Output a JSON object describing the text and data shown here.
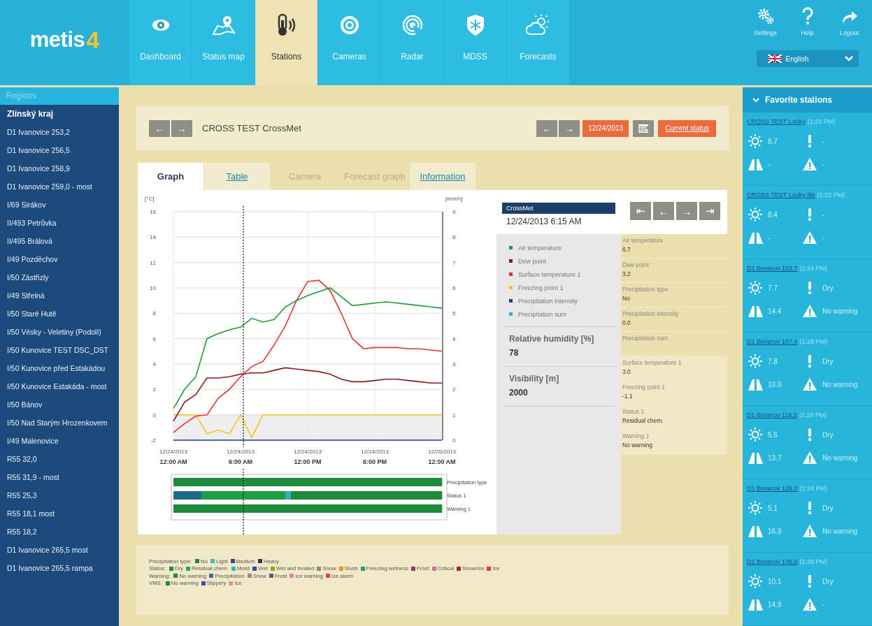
{
  "header": {
    "logo": {
      "text": "metis",
      "digit": "4"
    },
    "nav": [
      {
        "label": "Dashboard",
        "selected": false
      },
      {
        "label": "Status map",
        "selected": false
      },
      {
        "label": "Stations",
        "selected": true
      },
      {
        "label": "Cameras",
        "selected": false
      },
      {
        "label": "Radar",
        "selected": false
      },
      {
        "label": "MDSS",
        "selected": false
      },
      {
        "label": "Forecasts",
        "selected": false
      }
    ],
    "tools": [
      "Settings",
      "Help",
      "Logout"
    ],
    "language": "English"
  },
  "sidebar": {
    "title": "Regions",
    "region": "Zlínský kraj",
    "items": [
      "D1 Ivanovice 253,2",
      "D1 Ivanovice 256,5",
      "D1 Ivanovice 258,9",
      "D1 Ivanovice 259,0 - most",
      "I/69 Sirákov",
      "II/493 Petrůvka",
      "II/495 Brálová",
      "I/49 Pozděchov",
      "I/50 Zástřizly",
      "I/49 Střelná",
      "I/50 Staré Hutě",
      "I/50 Vésky - Veletiny (Podolí)",
      "I/50 Kunovice TEST DSC_DST",
      "I/50 Kunovice před Estakádou",
      "I/50 Kunovice Estakáda - most",
      "I/50 Bánov",
      "I/50 Nad Starým Hrozenkovem",
      "I/49 Malenovice",
      "R55 32,0",
      "R55 31,9 - most",
      "R55 25,3",
      "R55 18,1 most",
      "R55 18,2",
      "D1 Ivanovice 265,5 most",
      "D1 Ivanovice 265,5 rampa"
    ]
  },
  "station": {
    "prev": "←",
    "next": "→",
    "name": "CROSS TEST CrossMet",
    "date_prev": "←",
    "date_next": "→",
    "date": "12/24/2013",
    "current": "Current status"
  },
  "tabs": [
    {
      "label": "Graph",
      "selected": true,
      "disabled": false
    },
    {
      "label": "Table",
      "selected": false,
      "disabled": false
    },
    {
      "label": "Camera",
      "selected": false,
      "disabled": true
    },
    {
      "label": "Forecast graph",
      "selected": false,
      "disabled": true
    },
    {
      "label": "Information",
      "selected": false,
      "disabled": false
    }
  ],
  "graph": {
    "chart_data": {
      "type": "line",
      "ylabel": "[°C]",
      "y2label": "[mm/h]",
      "grid": true,
      "ylim": [
        -2,
        16
      ],
      "y2lim": [
        0,
        9
      ],
      "yticks": [
        -2,
        0,
        2,
        4,
        6,
        8,
        10,
        12,
        14,
        16
      ],
      "y2ticks": [
        0,
        1,
        2,
        3,
        4,
        5,
        6,
        7,
        8,
        9
      ],
      "categories": [
        "12/24/2013 **12:00 AM**",
        null,
        null,
        null,
        null,
        null,
        "12/24/2013 **6:00 AM**",
        null,
        null,
        null,
        null,
        null,
        "12/24/2013 **12:00 PM**",
        null,
        null,
        null,
        null,
        null,
        "12/24/2013 **6:00 PM**",
        null,
        null,
        null,
        null,
        null,
        "12/25/2013 **12:00 AM**"
      ],
      "series": [
        {
          "name": "Air temperature",
          "color": "#1e9a3c",
          "values": [
            0.5,
            2.0,
            3.0,
            6.0,
            6.4,
            6.7,
            6.9,
            7.6,
            7.3,
            7.5,
            8.5,
            9.0,
            9.4,
            9.7,
            10.0,
            9.3,
            8.6,
            8.7,
            8.8,
            8.9,
            8.8,
            8.7,
            8.6,
            8.5,
            8.4
          ]
        },
        {
          "name": "Dew point",
          "color": "#8a1a1a",
          "values": [
            -0.5,
            1.0,
            1.6,
            2.9,
            2.9,
            3.0,
            3.2,
            3.3,
            3.3,
            3.5,
            3.7,
            3.6,
            3.5,
            3.4,
            3.2,
            2.8,
            2.6,
            2.6,
            2.7,
            2.8,
            2.8,
            2.7,
            2.6,
            2.5,
            2.5
          ]
        },
        {
          "name": "Surface temperature 1",
          "color": "#e83030",
          "values": [
            -1.4,
            -0.7,
            -0.1,
            0.0,
            1.3,
            2.0,
            3.0,
            3.8,
            4.2,
            5.5,
            7.0,
            9.0,
            10.5,
            10.6,
            9.8,
            8.0,
            6.0,
            5.2,
            5.3,
            5.3,
            5.3,
            5.2,
            5.2,
            5.1,
            5.0
          ]
        },
        {
          "name": "Freezing point 1",
          "color": "#f0c81e",
          "values": [
            0,
            0,
            0,
            -1.5,
            -1.2,
            -1.5,
            0,
            -1.8,
            0,
            0,
            0,
            0,
            0,
            0,
            0,
            0,
            0,
            0,
            0,
            0,
            0,
            0,
            0,
            0,
            0
          ]
        },
        {
          "name": "Precipitation intensity",
          "color": "#1e3f8a",
          "axis": "y2",
          "values": [
            0,
            0,
            0,
            0,
            0,
            0,
            0,
            0,
            0,
            0,
            0,
            0,
            0,
            0,
            0,
            0,
            0,
            0,
            0,
            0,
            0,
            0,
            0,
            0,
            0
          ]
        },
        {
          "name": "Precipitation sum",
          "color": "#2ab0d8",
          "axis": "y2",
          "values": [
            null,
            null,
            null,
            null,
            null,
            null,
            null,
            null,
            null,
            null,
            null,
            null,
            null,
            null,
            null,
            null,
            null,
            null,
            null,
            null,
            null,
            null,
            null,
            null,
            null
          ]
        }
      ],
      "bands": [
        {
          "axis": "y",
          "from": -2,
          "to": 0,
          "color": "#eeeeee"
        }
      ]
    },
    "status_bars": [
      {
        "label": "Precipitation type",
        "slots": [
          {
            "color": "#1e8a3c"
          }
        ]
      },
      {
        "label": "Status 1",
        "slots": [
          {
            "color": "#1e6a8a"
          },
          {
            "color": "#1e6a8a"
          },
          {
            "color": "#1e6a8a"
          },
          {
            "color": "#1e6a8a"
          },
          {
            "color": "#1e6a8a"
          },
          {
            "color": "#1f9e48"
          },
          {
            "color": "#1f9e48"
          },
          {
            "color": "#1f9e48"
          },
          {
            "color": "#1f9e48"
          },
          {
            "color": "#1f9e48"
          },
          {
            "color": "#1f9e48"
          },
          {
            "color": "#1f9e48"
          },
          {
            "color": "#1f9e48"
          },
          {
            "color": "#1f9e48"
          },
          {
            "color": "#1f9e48"
          },
          {
            "color": "#1f9e48"
          },
          {
            "color": "#1f9e48"
          },
          {
            "color": "#1f9e48"
          },
          {
            "color": "#1f9e48"
          },
          {
            "color": "#1f9e48"
          },
          {
            "color": "#2ab0c0"
          },
          {
            "color": "#1e8a3c"
          },
          {
            "color": "#1e8a3c"
          },
          {
            "color": "#1e8a3c"
          },
          {
            "color": "#1e8a3c"
          },
          {
            "color": "#1e8a3c"
          },
          {
            "color": "#1e8a3c"
          },
          {
            "color": "#1e8a3c"
          },
          {
            "color": "#1e8a3c"
          },
          {
            "color": "#1e8a3c"
          },
          {
            "color": "#1e8a3c"
          },
          {
            "color": "#1e8a3c"
          },
          {
            "color": "#1e8a3c"
          },
          {
            "color": "#1e8a3c"
          },
          {
            "color": "#1e8a3c"
          },
          {
            "color": "#1e8a3c"
          },
          {
            "color": "#1e8a3c"
          },
          {
            "color": "#1e8a3c"
          },
          {
            "color": "#1e8a3c"
          },
          {
            "color": "#1e8a3c"
          },
          {
            "color": "#1e8a3c"
          },
          {
            "color": "#1e8a3c"
          },
          {
            "color": "#1e8a3c"
          },
          {
            "color": "#1e8a3c"
          },
          {
            "color": "#1e8a3c"
          },
          {
            "color": "#1e8a3c"
          },
          {
            "color": "#1e8a3c"
          },
          {
            "color": "#1e8a3c"
          }
        ]
      },
      {
        "label": "Warning 1",
        "slots": [
          {
            "color": "#1e8a3c"
          }
        ]
      }
    ]
  },
  "info": {
    "station": "CrossMet",
    "time": "12/24/2013 6:15 AM",
    "nav_buttons": [
      "⇤",
      "←",
      "→",
      "⇥"
    ],
    "extras": [
      {
        "label": "Relative humidity [%]",
        "value": "78"
      },
      {
        "label": "Visibility [m]",
        "value": "2000"
      }
    ],
    "groups": [
      [
        {
          "label": "Air temperature",
          "value": "6.7"
        },
        {
          "label": "Dew point",
          "value": "3.2"
        },
        {
          "label": "Precipitation type",
          "value": "No"
        },
        {
          "label": "Precipitation intensity",
          "value": "0.0"
        },
        {
          "label": "Precipitation sum"
        }
      ],
      [
        {
          "label": "Surface temperature 1",
          "value": "3.0"
        },
        {
          "label": "Freezing point 1",
          "value": "-1.1"
        },
        {
          "label": "Status 1",
          "value": "Residual chem."
        },
        {
          "label": "Warning 1",
          "value": "No warning"
        }
      ]
    ]
  },
  "legend": [
    {
      "label": "Precipitation type:",
      "items": [
        {
          "name": "No",
          "color": "#1e8a3c"
        },
        {
          "name": "Light",
          "color": "#3cc0c8"
        },
        {
          "name": "Medium",
          "color": "#2a4f7a"
        },
        {
          "name": "Heavy",
          "color": "#3a2f5a"
        }
      ]
    },
    {
      "label": "Status:",
      "items": [
        {
          "name": "Dry",
          "color": "#1e8a3c"
        },
        {
          "name": "Residual chem.",
          "color": "#2aa84a"
        },
        {
          "name": "Moist",
          "color": "#2ab0e0"
        },
        {
          "name": "Wet",
          "color": "#2a4f9a"
        },
        {
          "name": "Wet and treated",
          "color": "#9aa020"
        },
        {
          "name": "Snow",
          "color": "#8a8a8a"
        },
        {
          "name": "Slush",
          "color": "#f0902a"
        },
        {
          "name": "Freezing wetness",
          "color": "#1a9a8a"
        },
        {
          "name": "Frost",
          "color": "#8a3a7a"
        },
        {
          "name": "Critical",
          "color": "#d070a0"
        },
        {
          "name": "Snow/ice",
          "color": "#b0202a"
        },
        {
          "name": "Ice",
          "color": "#e83a3a"
        }
      ]
    },
    {
      "label": "Warning:",
      "items": [
        {
          "name": "No warning",
          "color": "#1e8a3c"
        },
        {
          "name": "Precipitation",
          "color": "#3a6ab0"
        },
        {
          "name": "Snow",
          "color": "#8a8a8a"
        },
        {
          "name": "Frost",
          "color": "#7a4a9a"
        },
        {
          "name": "Ice warning",
          "color": "#e080b0"
        },
        {
          "name": "Ice alarm",
          "color": "#e04040"
        }
      ]
    },
    {
      "label": "VMS:",
      "items": [
        {
          "name": "No warning",
          "color": "#1e8a3c"
        },
        {
          "name": "Slippery",
          "color": "#3a4ab0"
        },
        {
          "name": "Ice",
          "color": "#e090b0"
        }
      ]
    }
  ],
  "favorites": {
    "title": "Favorite stations",
    "stations": [
      {
        "name": "CROSS TEST Louky",
        "time": "(1:22 PM)",
        "air": "8.7",
        "status": "-",
        "road": "-",
        "warning": "-"
      },
      {
        "name": "CROSS TEST Louky lite",
        "time": "(1:22 PM)",
        "air": "8.4",
        "status": "-",
        "road": "-",
        "warning": "-"
      },
      {
        "name": "D1 Beranov 103,7",
        "time": "(1:24 PM)",
        "air": "7.7",
        "status": "Dry",
        "road": "14.4",
        "warning": "No warning"
      },
      {
        "name": "D1 Beranov 107,4",
        "time": "(1:28 PM)",
        "air": "7.8",
        "status": "Dry",
        "road": "10.0",
        "warning": "No warning"
      },
      {
        "name": "D1 Beranov 118,5",
        "time": "(1:28 PM)",
        "air": "5.6",
        "status": "Dry",
        "road": "13.7",
        "warning": "No warning"
      },
      {
        "name": "D1 Beranov 126,0",
        "time": "(1:24 PM)",
        "air": "5.1",
        "status": "Dry",
        "road": "16.9",
        "warning": "No warning"
      },
      {
        "name": "D1 Beranov 136,8",
        "time": "(1:38 PM)",
        "air": "10.1",
        "status": "Dry",
        "road": "14.9",
        "warning": "-"
      }
    ]
  }
}
